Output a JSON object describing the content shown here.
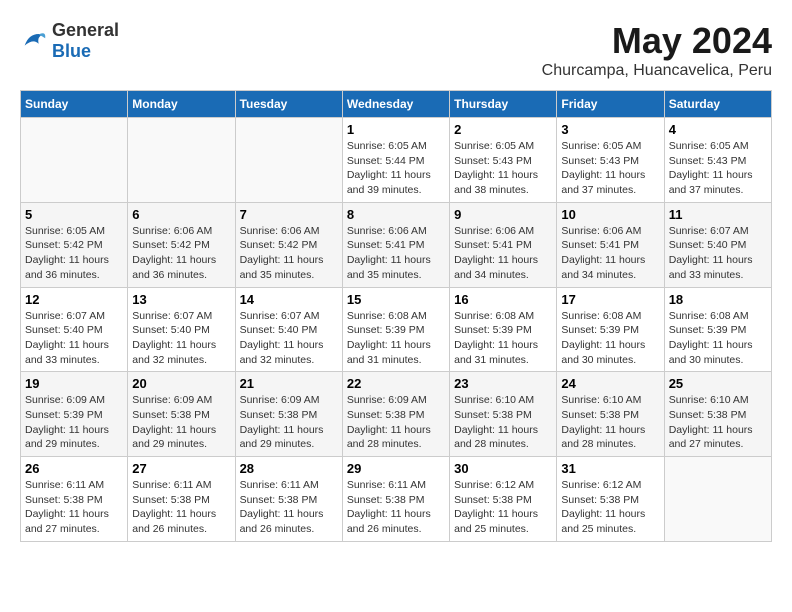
{
  "logo": {
    "general": "General",
    "blue": "Blue"
  },
  "header": {
    "month": "May 2024",
    "location": "Churcampa, Huancavelica, Peru"
  },
  "weekdays": [
    "Sunday",
    "Monday",
    "Tuesday",
    "Wednesday",
    "Thursday",
    "Friday",
    "Saturday"
  ],
  "weeks": [
    [
      {
        "day": "",
        "sunrise": "",
        "sunset": "",
        "daylight": "",
        "empty": true
      },
      {
        "day": "",
        "sunrise": "",
        "sunset": "",
        "daylight": "",
        "empty": true
      },
      {
        "day": "",
        "sunrise": "",
        "sunset": "",
        "daylight": "",
        "empty": true
      },
      {
        "day": "1",
        "sunrise": "Sunrise: 6:05 AM",
        "sunset": "Sunset: 5:44 PM",
        "daylight": "Daylight: 11 hours and 39 minutes."
      },
      {
        "day": "2",
        "sunrise": "Sunrise: 6:05 AM",
        "sunset": "Sunset: 5:43 PM",
        "daylight": "Daylight: 11 hours and 38 minutes."
      },
      {
        "day": "3",
        "sunrise": "Sunrise: 6:05 AM",
        "sunset": "Sunset: 5:43 PM",
        "daylight": "Daylight: 11 hours and 37 minutes."
      },
      {
        "day": "4",
        "sunrise": "Sunrise: 6:05 AM",
        "sunset": "Sunset: 5:43 PM",
        "daylight": "Daylight: 11 hours and 37 minutes."
      }
    ],
    [
      {
        "day": "5",
        "sunrise": "Sunrise: 6:05 AM",
        "sunset": "Sunset: 5:42 PM",
        "daylight": "Daylight: 11 hours and 36 minutes."
      },
      {
        "day": "6",
        "sunrise": "Sunrise: 6:06 AM",
        "sunset": "Sunset: 5:42 PM",
        "daylight": "Daylight: 11 hours and 36 minutes."
      },
      {
        "day": "7",
        "sunrise": "Sunrise: 6:06 AM",
        "sunset": "Sunset: 5:42 PM",
        "daylight": "Daylight: 11 hours and 35 minutes."
      },
      {
        "day": "8",
        "sunrise": "Sunrise: 6:06 AM",
        "sunset": "Sunset: 5:41 PM",
        "daylight": "Daylight: 11 hours and 35 minutes."
      },
      {
        "day": "9",
        "sunrise": "Sunrise: 6:06 AM",
        "sunset": "Sunset: 5:41 PM",
        "daylight": "Daylight: 11 hours and 34 minutes."
      },
      {
        "day": "10",
        "sunrise": "Sunrise: 6:06 AM",
        "sunset": "Sunset: 5:41 PM",
        "daylight": "Daylight: 11 hours and 34 minutes."
      },
      {
        "day": "11",
        "sunrise": "Sunrise: 6:07 AM",
        "sunset": "Sunset: 5:40 PM",
        "daylight": "Daylight: 11 hours and 33 minutes."
      }
    ],
    [
      {
        "day": "12",
        "sunrise": "Sunrise: 6:07 AM",
        "sunset": "Sunset: 5:40 PM",
        "daylight": "Daylight: 11 hours and 33 minutes."
      },
      {
        "day": "13",
        "sunrise": "Sunrise: 6:07 AM",
        "sunset": "Sunset: 5:40 PM",
        "daylight": "Daylight: 11 hours and 32 minutes."
      },
      {
        "day": "14",
        "sunrise": "Sunrise: 6:07 AM",
        "sunset": "Sunset: 5:40 PM",
        "daylight": "Daylight: 11 hours and 32 minutes."
      },
      {
        "day": "15",
        "sunrise": "Sunrise: 6:08 AM",
        "sunset": "Sunset: 5:39 PM",
        "daylight": "Daylight: 11 hours and 31 minutes."
      },
      {
        "day": "16",
        "sunrise": "Sunrise: 6:08 AM",
        "sunset": "Sunset: 5:39 PM",
        "daylight": "Daylight: 11 hours and 31 minutes."
      },
      {
        "day": "17",
        "sunrise": "Sunrise: 6:08 AM",
        "sunset": "Sunset: 5:39 PM",
        "daylight": "Daylight: 11 hours and 30 minutes."
      },
      {
        "day": "18",
        "sunrise": "Sunrise: 6:08 AM",
        "sunset": "Sunset: 5:39 PM",
        "daylight": "Daylight: 11 hours and 30 minutes."
      }
    ],
    [
      {
        "day": "19",
        "sunrise": "Sunrise: 6:09 AM",
        "sunset": "Sunset: 5:39 PM",
        "daylight": "Daylight: 11 hours and 29 minutes."
      },
      {
        "day": "20",
        "sunrise": "Sunrise: 6:09 AM",
        "sunset": "Sunset: 5:38 PM",
        "daylight": "Daylight: 11 hours and 29 minutes."
      },
      {
        "day": "21",
        "sunrise": "Sunrise: 6:09 AM",
        "sunset": "Sunset: 5:38 PM",
        "daylight": "Daylight: 11 hours and 29 minutes."
      },
      {
        "day": "22",
        "sunrise": "Sunrise: 6:09 AM",
        "sunset": "Sunset: 5:38 PM",
        "daylight": "Daylight: 11 hours and 28 minutes."
      },
      {
        "day": "23",
        "sunrise": "Sunrise: 6:10 AM",
        "sunset": "Sunset: 5:38 PM",
        "daylight": "Daylight: 11 hours and 28 minutes."
      },
      {
        "day": "24",
        "sunrise": "Sunrise: 6:10 AM",
        "sunset": "Sunset: 5:38 PM",
        "daylight": "Daylight: 11 hours and 28 minutes."
      },
      {
        "day": "25",
        "sunrise": "Sunrise: 6:10 AM",
        "sunset": "Sunset: 5:38 PM",
        "daylight": "Daylight: 11 hours and 27 minutes."
      }
    ],
    [
      {
        "day": "26",
        "sunrise": "Sunrise: 6:11 AM",
        "sunset": "Sunset: 5:38 PM",
        "daylight": "Daylight: 11 hours and 27 minutes."
      },
      {
        "day": "27",
        "sunrise": "Sunrise: 6:11 AM",
        "sunset": "Sunset: 5:38 PM",
        "daylight": "Daylight: 11 hours and 26 minutes."
      },
      {
        "day": "28",
        "sunrise": "Sunrise: 6:11 AM",
        "sunset": "Sunset: 5:38 PM",
        "daylight": "Daylight: 11 hours and 26 minutes."
      },
      {
        "day": "29",
        "sunrise": "Sunrise: 6:11 AM",
        "sunset": "Sunset: 5:38 PM",
        "daylight": "Daylight: 11 hours and 26 minutes."
      },
      {
        "day": "30",
        "sunrise": "Sunrise: 6:12 AM",
        "sunset": "Sunset: 5:38 PM",
        "daylight": "Daylight: 11 hours and 25 minutes."
      },
      {
        "day": "31",
        "sunrise": "Sunrise: 6:12 AM",
        "sunset": "Sunset: 5:38 PM",
        "daylight": "Daylight: 11 hours and 25 minutes."
      },
      {
        "day": "",
        "sunrise": "",
        "sunset": "",
        "daylight": "",
        "empty": true
      }
    ]
  ]
}
